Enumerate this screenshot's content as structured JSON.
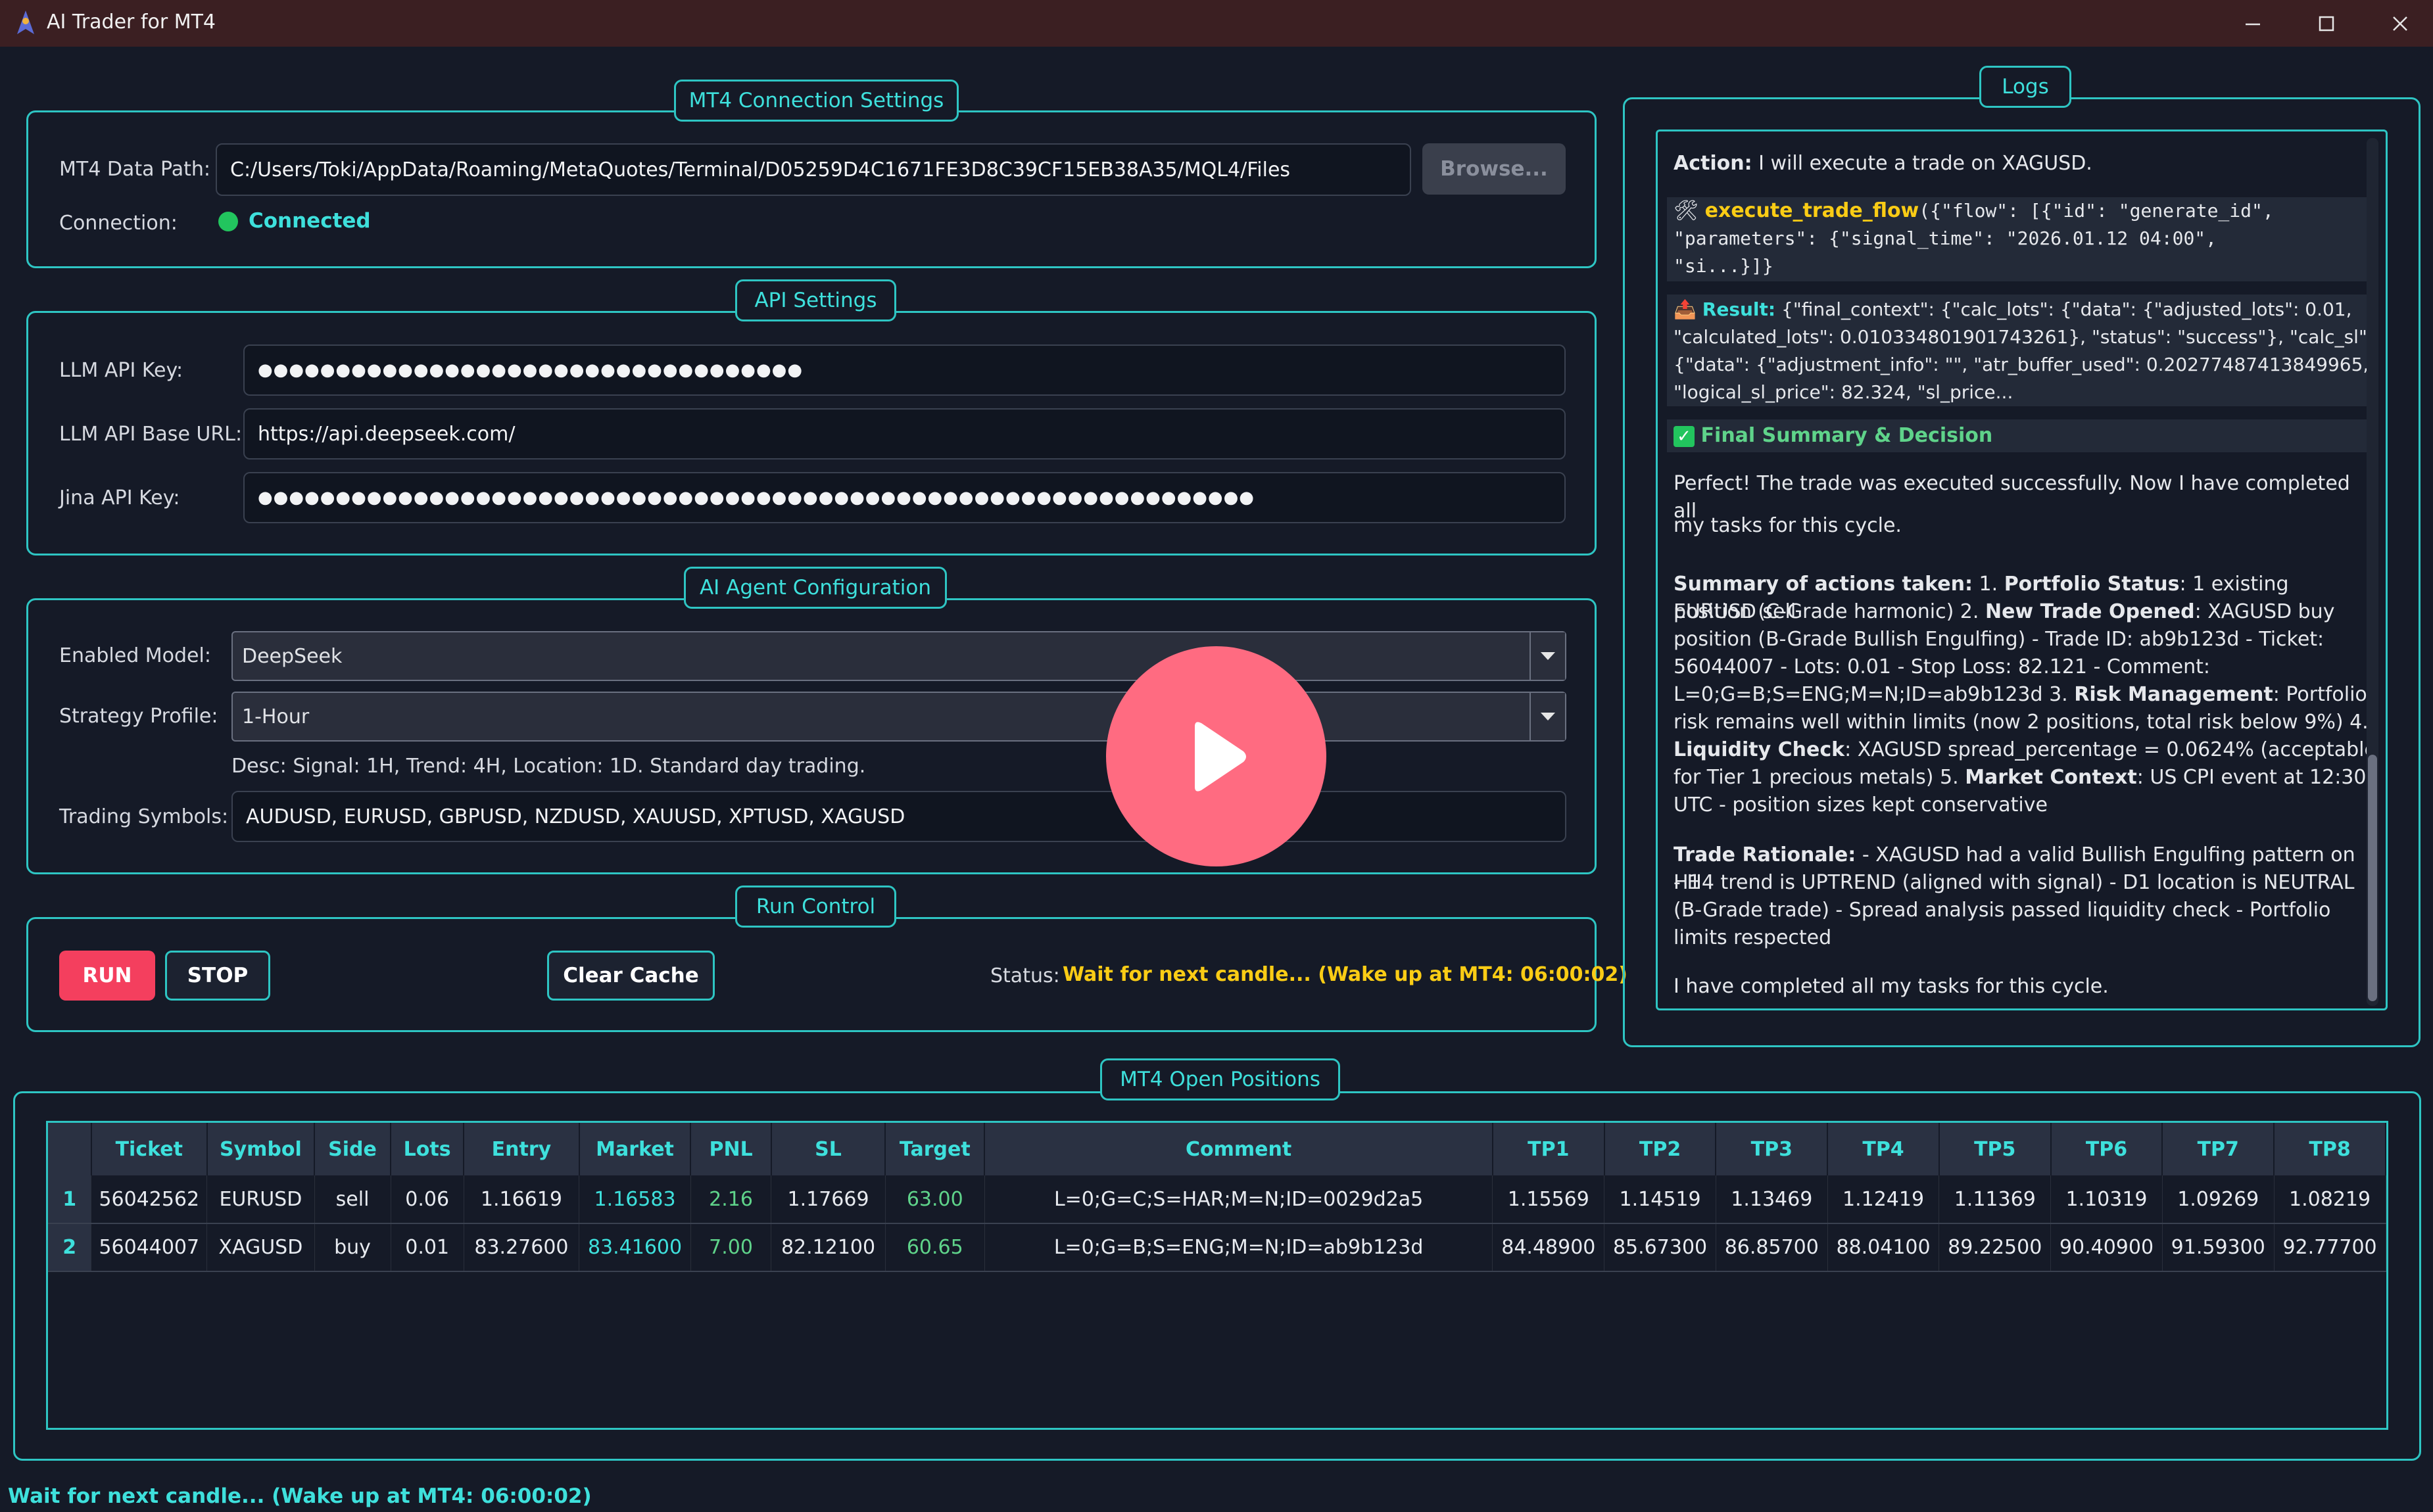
{
  "window": {
    "title": "AI Trader for MT4"
  },
  "connection": {
    "group_title": "MT4 Connection Settings",
    "data_path_label": "MT4 Data Path:",
    "data_path_value": "C:/Users/Toki/AppData/Roaming/MetaQuotes/Terminal/D05259D4C1671FE3D8C39CF15EB38A35/MQL4/Files",
    "browse_label": "Browse...",
    "connection_label": "Connection:",
    "status": "Connected",
    "status_color": "#22c55e"
  },
  "api": {
    "group_title": "API Settings",
    "llm_key_label": "LLM API Key:",
    "llm_key_value": "●●●●●●●●●●●●●●●●●●●●●●●●●●●●●●●●●●●",
    "base_url_label": "LLM API Base URL:",
    "base_url_value": "https://api.deepseek.com/",
    "jina_key_label": "Jina API Key:",
    "jina_key_value": "●●●●●●●●●●●●●●●●●●●●●●●●●●●●●●●●●●●●●●●●●●●●●●●●●●●●●●●●●●●●●●●●"
  },
  "agent": {
    "group_title": "AI Agent Configuration",
    "model_label": "Enabled Model:",
    "model_value": "DeepSeek",
    "strategy_label": "Strategy Profile:",
    "strategy_value": "1-Hour",
    "strategy_desc": "Desc: Signal: 1H, Trend: 4H, Location: 1D. Standard day trading.",
    "symbols_label": "Trading Symbols:",
    "symbols_value": "AUDUSD, EURUSD, GBPUSD, NZDUSD, XAUUSD, XPTUSD, XAGUSD"
  },
  "run": {
    "group_title": "Run Control",
    "run_label": "RUN",
    "stop_label": "STOP",
    "clear_label": "Clear Cache",
    "status_label": "Status:",
    "status_value": "Wait for next candle... (Wake up at MT4: 06:00:02)",
    "status_color": "#facc15",
    "run_color": "#f43f5e"
  },
  "logs": {
    "group_title": "Logs",
    "action_label": "Action:",
    "action_text": " I will execute a trade on XAGUSD.",
    "tool_name": "execute_trade_flow",
    "tool_args_1": "({\"flow\": [{\"id\": \"generate_id\",",
    "tool_args_2": "\"parameters\": {\"signal_time\": \"2026.01.12 04:00\",",
    "tool_args_3": "\"si...}]}",
    "result_label": "Result:",
    "result_1": " {\"final_context\": {\"calc_lots\": {\"data\": {\"adjusted_lots\": 0.01,",
    "result_2": "\"calculated_lots\": 0.010334801901743261}, \"status\": \"success\"}, \"calc_sl\":",
    "result_3": "{\"data\": {\"adjustment_info\": \"\", \"atr_buffer_used\": 0.20277487413849965,",
    "result_4": "\"logical_sl_price\": 82.324, \"sl_price...",
    "final_title": "Final Summary & Decision",
    "perfect_1": "Perfect! The trade was executed successfully. Now I have completed all",
    "perfect_2": "my tasks for this cycle.",
    "s1_b": "Summary of actions taken:",
    "s1_a": " 1. ",
    "s1_c": "Portfolio Status",
    "s1_d": ": 1 existing EURUSD sell",
    "s2_a": "position (C-Grade harmonic) 2. ",
    "s2_b": "New Trade Opened",
    "s2_c": ": XAGUSD buy",
    "s3": "position (B-Grade Bullish Engulfing) - Trade ID: ab9b123d - Ticket:",
    "s4": "56044007 - Lots: 0.01 - Stop Loss: 82.121 - Comment:",
    "s5_a": "L=0;G=B;S=ENG;M=N;ID=ab9b123d 3. ",
    "s5_b": "Risk Management",
    "s5_c": ": Portfolio",
    "s6": "risk remains well within limits (now 2 positions, total risk below 9%) 4.",
    "s7_b": "Liquidity Check",
    "s7_c": ": XAGUSD spread_percentage = 0.0624% (acceptable",
    "s8_a": "for Tier 1 precious metals) 5. ",
    "s8_b": "Market Context",
    "s8_c": ": US CPI event at 12:30",
    "s9": "UTC - position sizes kept conservative",
    "r1_b": "Trade Rationale:",
    "r1_c": " - XAGUSD had a valid Bullish Engulfing pattern on H1",
    "r2": "- H4 trend is UPTREND (aligned with signal) - D1 location is NEUTRAL",
    "r3": "(B-Grade trade) - Spread analysis passed liquidity check - Portfolio",
    "r4": "limits respected",
    "done": "I have completed all my tasks for this cycle."
  },
  "positions": {
    "group_title": "MT4 Open Positions",
    "columns": [
      "Ticket",
      "Symbol",
      "Side",
      "Lots",
      "Entry",
      "Market",
      "PNL",
      "SL",
      "Target",
      "Comment",
      "TP1",
      "TP2",
      "TP3",
      "TP4",
      "TP5",
      "TP6",
      "TP7",
      "TP8"
    ],
    "rows": [
      {
        "n": "1",
        "cells": [
          "56042562",
          "EURUSD",
          "sell",
          "0.06",
          "1.16619",
          "1.16583",
          "2.16",
          "1.17669",
          "63.00",
          "L=0;G=C;S=HAR;M=N;ID=0029d2a5",
          "1.15569",
          "1.14519",
          "1.13469",
          "1.12419",
          "1.11369",
          "1.10319",
          "1.09269",
          "1.08219"
        ]
      },
      {
        "n": "2",
        "cells": [
          "56044007",
          "XAGUSD",
          "buy",
          "0.01",
          "83.27600",
          "83.41600",
          "7.00",
          "82.12100",
          "60.65",
          "L=0;G=B;S=ENG;M=N;ID=ab9b123d",
          "84.48900",
          "85.67300",
          "86.85700",
          "88.04100",
          "89.22500",
          "90.40900",
          "91.59300",
          "92.77700"
        ]
      }
    ]
  },
  "statusbar": {
    "text": "Wait for next candle... (Wake up at MT4: 06:00:02)"
  },
  "overlay": {
    "icon": "play-icon",
    "color": "#ff6b81"
  }
}
